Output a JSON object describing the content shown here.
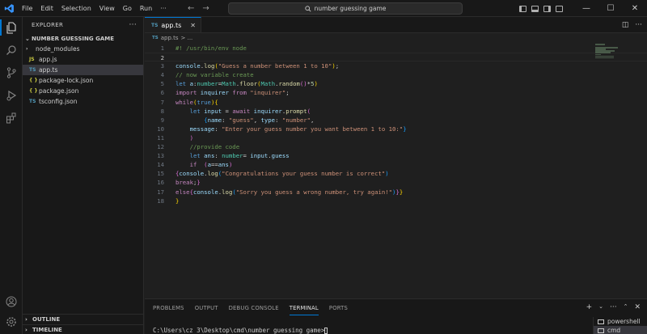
{
  "titlebar": {
    "menus": [
      "File",
      "Edit",
      "Selection",
      "View",
      "Go",
      "Run",
      "···"
    ],
    "search": "number guessing game"
  },
  "sidebar": {
    "title": "EXPLORER",
    "more": "···",
    "folder": "NUMBER GUESSING GAME",
    "items": [
      {
        "label": "node_modules",
        "icon": "›",
        "icon_color": "#cccccc",
        "indent": 4,
        "selected": false
      },
      {
        "label": "app.js",
        "icon": "JS",
        "icon_color": "#cbcb41",
        "indent": 8,
        "selected": false
      },
      {
        "label": "app.ts",
        "icon": "TS",
        "icon_color": "#519aba",
        "indent": 8,
        "selected": true
      },
      {
        "label": "package-lock.json",
        "icon": "{ }",
        "icon_color": "#cbcb41",
        "indent": 8,
        "selected": false
      },
      {
        "label": "package.json",
        "icon": "{ }",
        "icon_color": "#cbcb41",
        "indent": 8,
        "selected": false
      },
      {
        "label": "tsconfig.json",
        "icon": "TS",
        "icon_color": "#519aba",
        "indent": 8,
        "selected": false
      }
    ],
    "outline": "OUTLINE",
    "timeline": "TIMELINE"
  },
  "editor": {
    "tab_icon": "TS",
    "tab_label": "app.ts",
    "breadcrumb_icon": "TS",
    "breadcrumb_file": "app.ts",
    "breadcrumb_sep": "> ...",
    "current_line": 2,
    "lines": [
      [
        [
          "c-comment",
          "#! /usr/bin/env node"
        ]
      ],
      [],
      [
        [
          "c-var",
          "console"
        ],
        [
          "c-def",
          "."
        ],
        [
          "c-fn",
          "log"
        ],
        [
          "c-br1",
          "("
        ],
        [
          "c-str",
          "\"Guess a number between 1 to 10\""
        ],
        [
          "c-br1",
          ")"
        ],
        [
          "c-def",
          ";"
        ]
      ],
      [
        [
          "c-comment",
          "// now variable create"
        ]
      ],
      [
        [
          "c-kw",
          "let "
        ],
        [
          "c-var",
          "a"
        ],
        [
          "c-def",
          ":"
        ],
        [
          "c-type",
          "number"
        ],
        [
          "c-def",
          "="
        ],
        [
          "c-type",
          "Math"
        ],
        [
          "c-def",
          "."
        ],
        [
          "c-fn",
          "floor"
        ],
        [
          "c-br1",
          "("
        ],
        [
          "c-type",
          "Math"
        ],
        [
          "c-def",
          "."
        ],
        [
          "c-fn",
          "random"
        ],
        [
          "c-br2",
          "()"
        ],
        [
          "c-def",
          "*"
        ],
        [
          "c-num",
          "5"
        ],
        [
          "c-br1",
          ")"
        ]
      ],
      [
        [
          "c-ctrl",
          "import "
        ],
        [
          "c-var",
          "inquirer "
        ],
        [
          "c-ctrl",
          "from "
        ],
        [
          "c-str",
          "\"inquirer\""
        ],
        [
          "c-def",
          ";"
        ]
      ],
      [
        [
          "c-ctrl",
          "while"
        ],
        [
          "c-br1",
          "("
        ],
        [
          "c-kw",
          "true"
        ],
        [
          "c-br1",
          ")"
        ],
        [
          "c-br1",
          "{"
        ]
      ],
      [
        [
          "c-def",
          "    "
        ],
        [
          "c-kw",
          "let "
        ],
        [
          "c-var",
          "input "
        ],
        [
          "c-def",
          "= "
        ],
        [
          "c-ctrl",
          "await "
        ],
        [
          "c-var",
          "inquirer"
        ],
        [
          "c-def",
          "."
        ],
        [
          "c-fn",
          "prompt"
        ],
        [
          "c-br2",
          "("
        ]
      ],
      [
        [
          "c-def",
          "        "
        ],
        [
          "c-br3",
          "{"
        ],
        [
          "c-var",
          "name"
        ],
        [
          "c-def",
          ": "
        ],
        [
          "c-str",
          "\"guess\""
        ],
        [
          "c-def",
          ", "
        ],
        [
          "c-var",
          "type"
        ],
        [
          "c-def",
          ": "
        ],
        [
          "c-str",
          "\"number\""
        ],
        [
          "c-def",
          ","
        ]
      ],
      [
        [
          "c-def",
          "    "
        ],
        [
          "c-var",
          "message"
        ],
        [
          "c-def",
          ": "
        ],
        [
          "c-str",
          "\"Enter your guess number you want between 1 to 10:\""
        ],
        [
          "c-br3",
          "}"
        ]
      ],
      [
        [
          "c-def",
          "    "
        ],
        [
          "c-br2",
          ")"
        ]
      ],
      [
        [
          "c-def",
          "    "
        ],
        [
          "c-comment",
          "//provide code"
        ]
      ],
      [
        [
          "c-def",
          "    "
        ],
        [
          "c-kw",
          "let "
        ],
        [
          "c-var",
          "ans"
        ],
        [
          "c-def",
          ": "
        ],
        [
          "c-type",
          "number"
        ],
        [
          "c-def",
          "= "
        ],
        [
          "c-var",
          "input"
        ],
        [
          "c-def",
          "."
        ],
        [
          "c-var",
          "guess"
        ]
      ],
      [
        [
          "c-def",
          "    "
        ],
        [
          "c-ctrl",
          "if  "
        ],
        [
          "c-br2",
          "("
        ],
        [
          "c-var",
          "a"
        ],
        [
          "c-def",
          "=="
        ],
        [
          "c-var",
          "ans"
        ],
        [
          "c-br2",
          ")"
        ]
      ],
      [
        [
          "c-br2",
          "{"
        ],
        [
          "c-var",
          "console"
        ],
        [
          "c-def",
          "."
        ],
        [
          "c-fn",
          "log"
        ],
        [
          "c-br3",
          "("
        ],
        [
          "c-str",
          "\"Congratulations your guess number is correct\""
        ],
        [
          "c-br3",
          ")"
        ]
      ],
      [
        [
          "c-ctrl",
          "break"
        ],
        [
          "c-def",
          ";"
        ],
        [
          "c-br2",
          "}"
        ]
      ],
      [
        [
          "c-ctrl",
          "else"
        ],
        [
          "c-br2",
          "{"
        ],
        [
          "c-var",
          "console"
        ],
        [
          "c-def",
          "."
        ],
        [
          "c-fn",
          "log"
        ],
        [
          "c-br3",
          "("
        ],
        [
          "c-str",
          "\"Sorry you guess a wrong number, try again!\""
        ],
        [
          "c-br3",
          ")"
        ],
        [
          "c-br2",
          "}"
        ],
        [
          "c-br1",
          "}"
        ]
      ],
      [
        [
          "c-br1",
          "}"
        ]
      ]
    ]
  },
  "panel": {
    "tabs": [
      "PROBLEMS",
      "OUTPUT",
      "DEBUG CONSOLE",
      "TERMINAL",
      "PORTS"
    ],
    "active_tab": "TERMINAL",
    "prompt": "C:\\Users\\cz 3\\Desktop\\cmd\\number guessing game>",
    "terminals": [
      {
        "label": "powershell",
        "active": false
      },
      {
        "label": "cmd",
        "active": true
      }
    ]
  }
}
